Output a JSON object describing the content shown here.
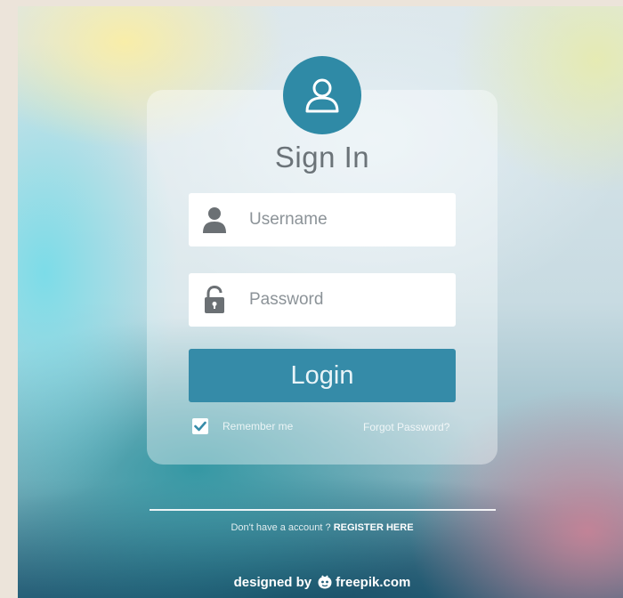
{
  "login_form": {
    "title": "Sign In",
    "username": {
      "placeholder": "Username",
      "value": "",
      "icon": "user-icon"
    },
    "password": {
      "placeholder": "Password",
      "value": "",
      "icon": "lock-icon"
    },
    "login_label": "Login",
    "remember": {
      "label": "Remember me",
      "checked": true
    },
    "forgot_label": "Forgot Password?"
  },
  "register": {
    "prompt": "Don't have a account ? ",
    "link_label": "REGISTER HERE"
  },
  "credit": {
    "prefix": "designed by",
    "brand": "freepik.com"
  },
  "colors": {
    "accent": "#358ba8",
    "avatar": "#2f8aa6",
    "field_icon": "#6b7074"
  }
}
